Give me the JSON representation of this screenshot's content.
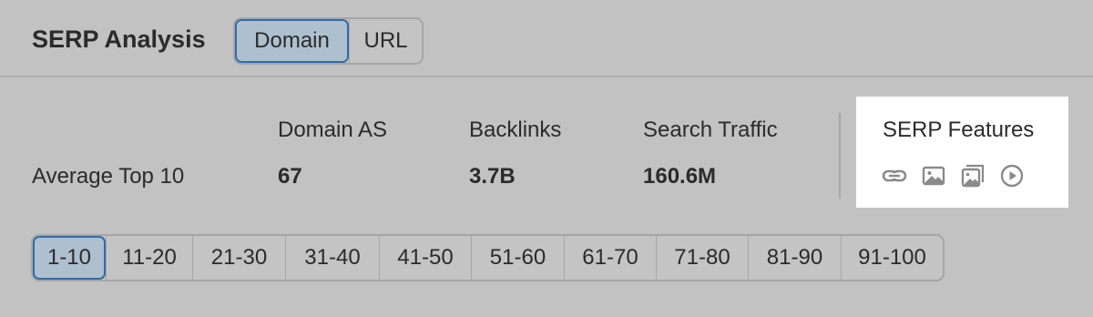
{
  "header": {
    "title": "SERP Analysis",
    "toggle": [
      {
        "label": "Domain",
        "active": true
      },
      {
        "label": "URL",
        "active": false
      }
    ]
  },
  "summary": {
    "row_label": "Average Top 10",
    "metrics": [
      {
        "label": "Domain AS",
        "value": "67"
      },
      {
        "label": "Backlinks",
        "value": "3.7B"
      },
      {
        "label": "Search Traffic",
        "value": "160.6M"
      }
    ]
  },
  "serp_features": {
    "title": "SERP Features",
    "icons": [
      "link-icon",
      "image-icon",
      "image-pack-icon",
      "video-icon"
    ]
  },
  "pagination": {
    "ranges": [
      "1-10",
      "11-20",
      "21-30",
      "31-40",
      "41-50",
      "51-60",
      "61-70",
      "71-80",
      "81-90",
      "91-100"
    ],
    "active_index": 0
  },
  "colors": {
    "background": "#c2c2c2",
    "active_border": "#2e6daa",
    "active_fill": "#aebfce",
    "icon": "#8a8a8a"
  }
}
